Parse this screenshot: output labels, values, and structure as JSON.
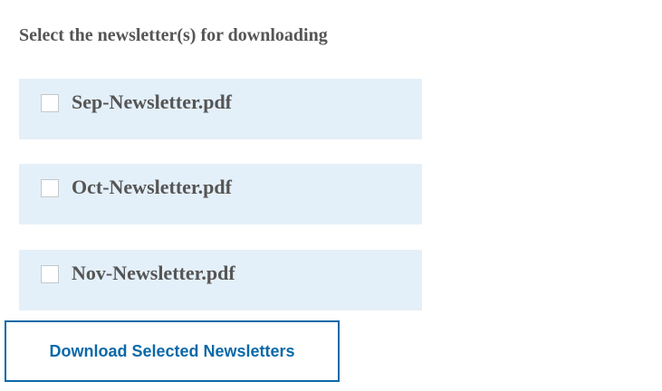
{
  "heading": "Select the newsletter(s) for downloading",
  "files": [
    {
      "label": "Sep-Newsletter.pdf",
      "checked": false
    },
    {
      "label": "Oct-Newsletter.pdf",
      "checked": false
    },
    {
      "label": "Nov-Newsletter.pdf",
      "checked": false
    }
  ],
  "download_button": {
    "label": "Download Selected Newsletters"
  },
  "colors": {
    "option_background": "#e4f0f9",
    "text": "#555555",
    "accent": "#0b69a8",
    "checkbox_border": "#c2c8cc"
  },
  "icons": {
    "checkbox": "checkbox-unchecked-icon"
  }
}
